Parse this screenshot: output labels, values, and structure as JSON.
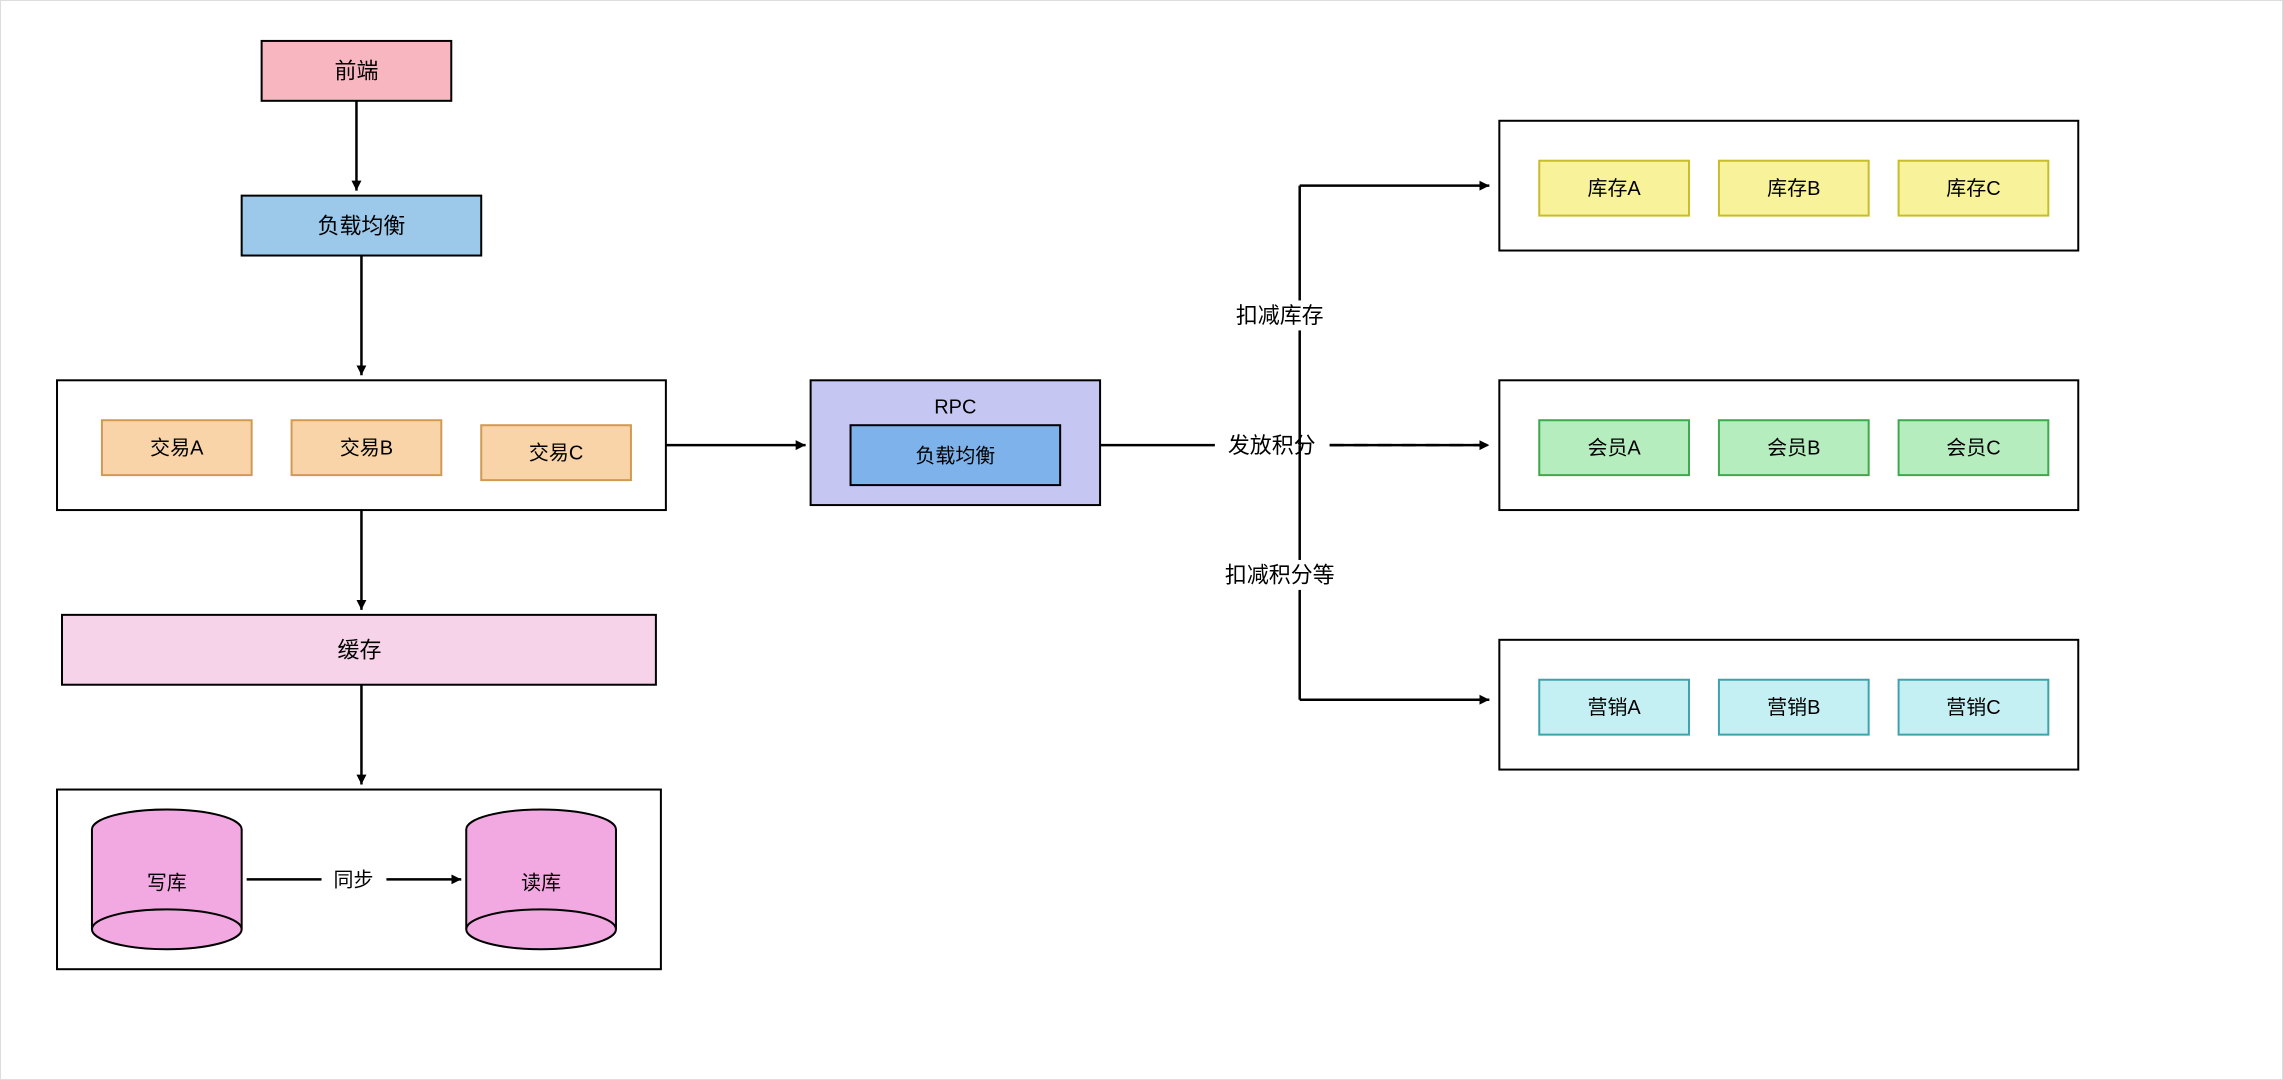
{
  "nodes": {
    "frontend": "前端",
    "lb": "负载均衡",
    "trxA": "交易A",
    "trxB": "交易B",
    "trxC": "交易C",
    "cache": "缓存",
    "writeDB": "写库",
    "readDB": "读库",
    "sync": "同步",
    "rpcTitle": "RPC",
    "rpcLB": "负载均衡",
    "stockA": "库存A",
    "stockB": "库存B",
    "stockC": "库存C",
    "memberA": "会员A",
    "memberB": "会员B",
    "memberC": "会员C",
    "mktA": "营销A",
    "mktB": "营销B",
    "mktC": "营销C"
  },
  "edges": {
    "dedStock": "扣减库存",
    "issuePoints": "发放积分",
    "dedPoints": "扣减积分等"
  },
  "colors": {
    "pinkFill": "#f7b6c0",
    "pinkStroke": "#000",
    "blueFill": "#9cc8ea",
    "orangeFill": "#f8d4a8",
    "orangeStroke": "#d19a54",
    "lightPink": "#f6d3e8",
    "purpleFill": "#c5c6f2",
    "blueBox": "#7db3ea",
    "yellowFill": "#f8f29a",
    "yellowStroke": "#c7bd2b",
    "greenFill": "#b5edbf",
    "greenStroke": "#3fa84f",
    "cyanFill": "#c4f0f4",
    "cyanStroke": "#3fa2ab",
    "cylFill": "#f2a9e2",
    "cylStroke": "#000"
  }
}
